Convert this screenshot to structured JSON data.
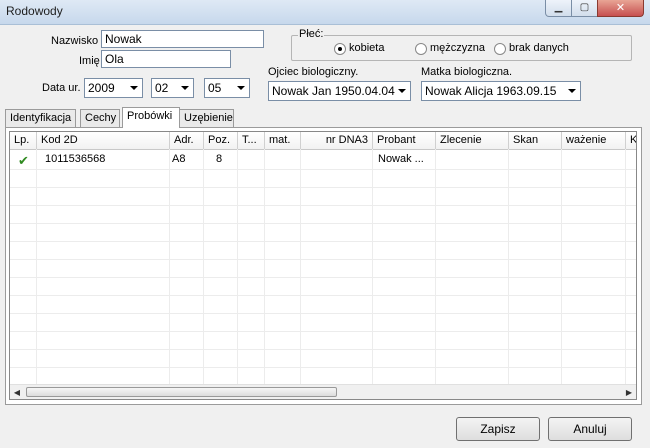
{
  "window": {
    "title": "Rodowody"
  },
  "form": {
    "nazwisko_label": "Nazwisko",
    "nazwisko_value": "Nowak",
    "imie_label": "Imię",
    "imie_value": "Ola",
    "data_label": "Data ur.",
    "year": "2009",
    "month": "02",
    "day": "05",
    "plec_label": "Płeć:",
    "plec_options": [
      "kobieta",
      "mężczyzna",
      "brak danych"
    ],
    "plec_selected": "kobieta",
    "ojciec_label": "Ojciec biologiczny.",
    "ojciec_value": "Nowak Jan 1950.04.04",
    "matka_label": "Matka biologiczna.",
    "matka_value": "Nowak Alicja 1963.09.15"
  },
  "tabs": [
    {
      "label": "Identyfikacja",
      "active": false
    },
    {
      "label": "Cechy",
      "active": false
    },
    {
      "label": "Probówki",
      "active": true
    },
    {
      "label": "Uzębienie",
      "active": false
    }
  ],
  "table": {
    "columns": [
      "Lp.",
      "Kod 2D",
      "Adr.",
      "Poz.",
      "T...",
      "mat.",
      "nr DNA3",
      "Probant",
      "Zlecenie",
      "Skan",
      "ważenie",
      "K"
    ],
    "rows": [
      {
        "check": true,
        "kod": "1011536568",
        "adr": "A8",
        "poz": "8",
        "probant": "Nowak ..."
      }
    ]
  },
  "buttons": {
    "save": "Zapisz",
    "cancel": "Anuluj"
  },
  "colors": {
    "accent_check": "#2f8a20",
    "close_button": "#c75050"
  }
}
